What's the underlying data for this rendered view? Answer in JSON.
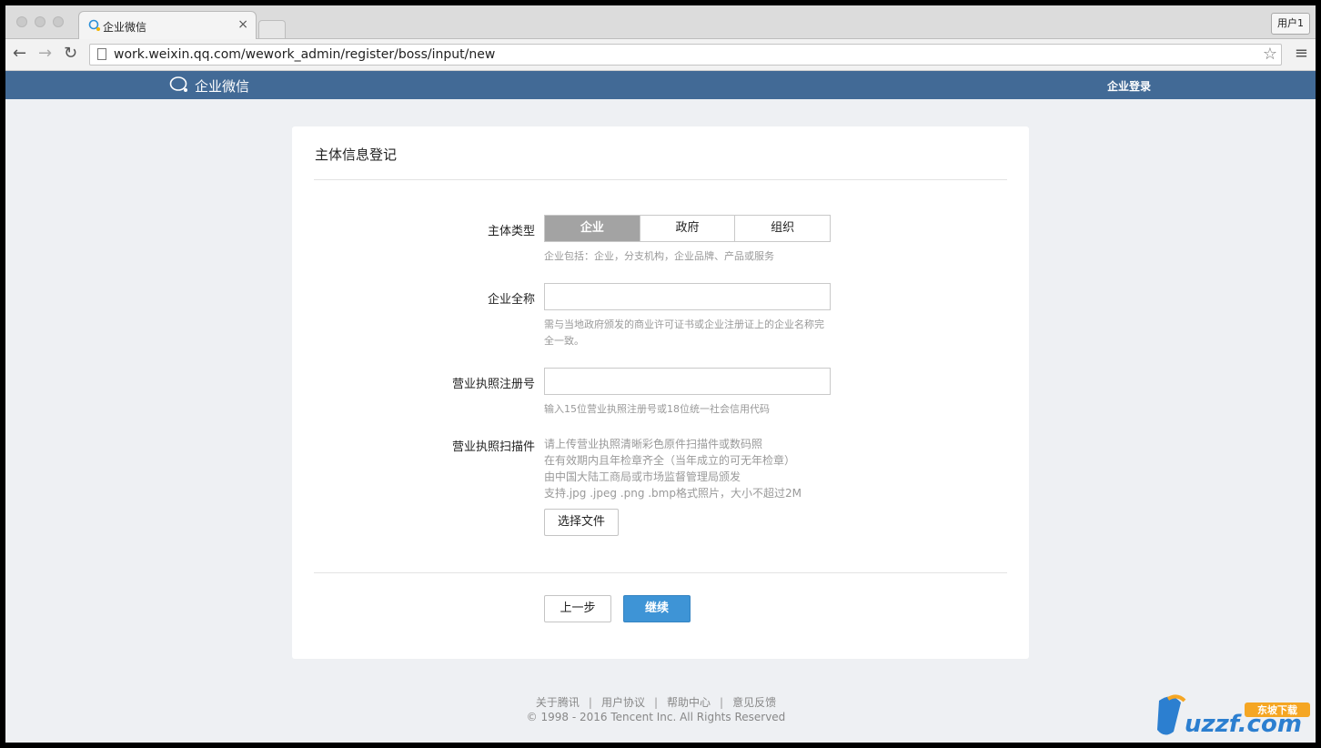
{
  "browser": {
    "tab_title": "企业微信",
    "tab_close": "×",
    "user_button": "用户1",
    "url": "work.weixin.qq.com/wework_admin/register/boss/input/new",
    "back_icon": "arrow-left-icon",
    "forward_icon": "arrow-right-icon",
    "reload_icon": "reload-icon",
    "star_icon": "star-icon",
    "menu_icon": "hamburger-menu-icon"
  },
  "site_header": {
    "logo_text": "企业微信",
    "login_link": "企业登录",
    "bg_color": "#426a96"
  },
  "form": {
    "title": "主体信息登记",
    "entity_type": {
      "label": "主体类型",
      "options": [
        "企业",
        "政府",
        "组织"
      ],
      "selected": "企业",
      "hint": "企业包括：企业，分支机构，企业品牌、产品或服务"
    },
    "company_name": {
      "label": "企业全称",
      "value": "",
      "hint": "需与当地政府颁发的商业许可证书或企业注册证上的企业名称完全一致。"
    },
    "license_number": {
      "label": "营业执照注册号",
      "value": "",
      "hint": "输入15位营业执照注册号或18位统一社会信用代码"
    },
    "license_scan": {
      "label": "营业执照扫描件",
      "hints": [
        "请上传营业执照清晰彩色原件扫描件或数码照",
        "在有效期内且年检章齐全（当年成立的可无年检章）",
        "由中国大陆工商局或市场监督管理局颁发",
        "支持.jpg .jpeg .png .bmp格式照片，大小不超过2M"
      ],
      "choose_file_button": "选择文件"
    },
    "prev_button": "上一步",
    "continue_button": "继续",
    "primary_color": "#3e94d6"
  },
  "footer": {
    "links": [
      "关于腾讯",
      "用户协议",
      "帮助中心",
      "意见反馈"
    ],
    "separator": "|",
    "copyright": "© 1998 - 2016 Tencent Inc. All Rights Reserved"
  },
  "watermark": {
    "text": "uzzf.com",
    "badge": "东坡下载"
  }
}
